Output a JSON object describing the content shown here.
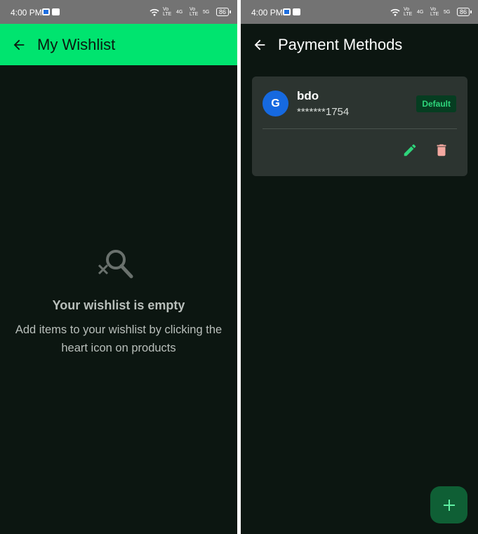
{
  "status_bar": {
    "time": "4:00 PM",
    "signal_labels": [
      "Vo LTE",
      "4G",
      "Vo LTE",
      "5G"
    ],
    "battery": "86"
  },
  "wishlist_screen": {
    "title": "My Wishlist",
    "back_icon": "arrow-left-icon",
    "empty_state": {
      "icon": "search-off-icon",
      "title": "Your wishlist is empty",
      "subtitle": "Add items to your wishlist by clicking the heart icon on products"
    },
    "colors": {
      "appbar": "#00e46f",
      "background": "#0c1611"
    }
  },
  "payment_screen": {
    "title": "Payment Methods",
    "back_icon": "arrow-left-icon",
    "methods": [
      {
        "avatar_letter": "G",
        "name": "bdo",
        "number": "*******1754",
        "badge": "Default"
      }
    ],
    "fab_icon": "plus-icon",
    "colors": {
      "card": "#2c3430",
      "accent": "#2ed57b",
      "avatar": "#1669e0",
      "delete": "#f4a8a0"
    }
  }
}
